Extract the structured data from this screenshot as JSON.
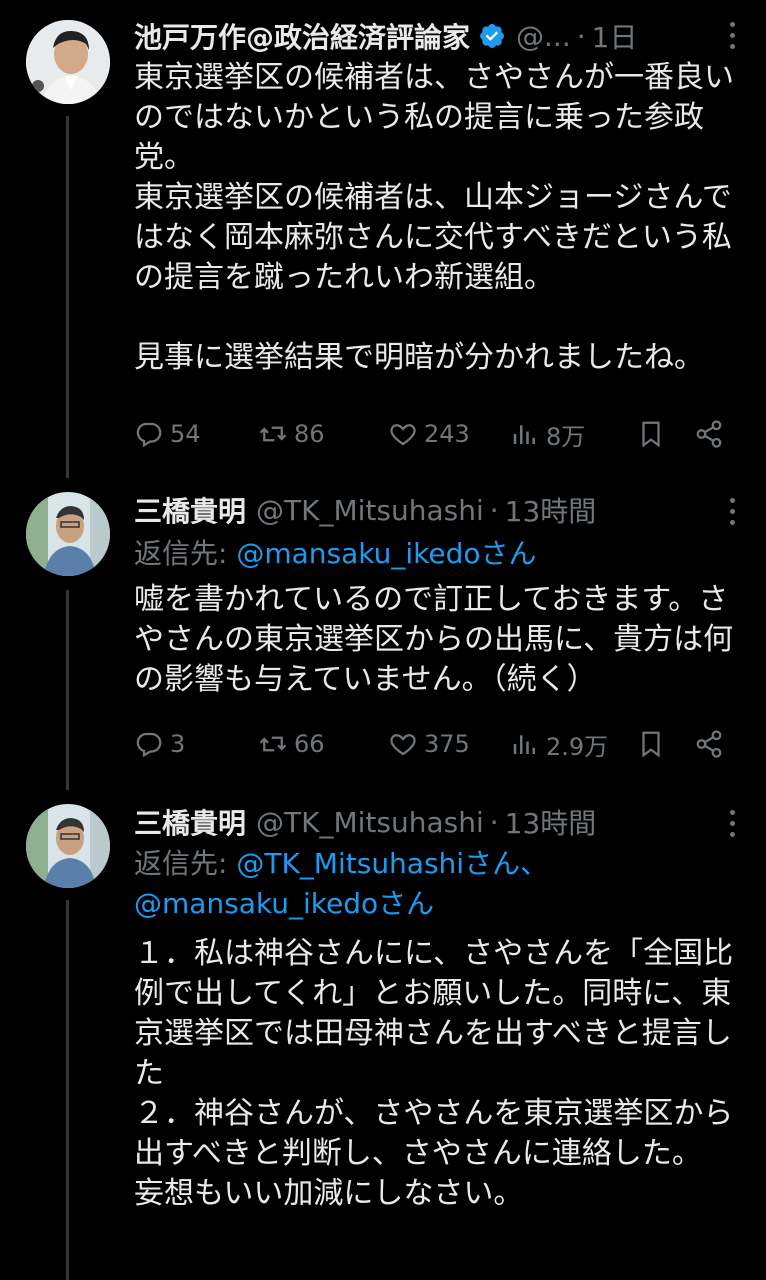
{
  "tweets": [
    {
      "name": "池戸万作@政治経済評論家",
      "handle": "@...",
      "time": "1日",
      "text": "東京選挙区の候補者は、さやさんが一番良いのではないかという私の提言に乗った参政党。\n東京選挙区の候補者は、山本ジョージさんではなく岡本麻弥さんに交代すべきだという私の提言を蹴ったれいわ新選組。\n\n見事に選挙結果で明暗が分かれましたね。",
      "replies": "54",
      "retweets": "86",
      "likes": "243",
      "views": "8万"
    },
    {
      "name": "三橋貴明",
      "handle": "@TK_Mitsuhashi",
      "time": "13時間",
      "reply_prefix": "返信先: ",
      "reply_mentions": "@mansaku_ikedoさん",
      "text": "嘘を書かれているので訂正しておきます。さやさんの東京選挙区からの出馬に、貴方は何の影響も与えていません。（続く）",
      "replies": "3",
      "retweets": "66",
      "likes": "375",
      "views": "2.9万"
    },
    {
      "name": "三橋貴明",
      "handle": "@TK_Mitsuhashi",
      "time": "13時間",
      "reply_prefix": "返信先: ",
      "reply_mentions_1": "@TK_Mitsuhashiさん、",
      "reply_mentions_2": "@mansaku_ikedoさん",
      "text": "１．私は神谷さんにに、さやさんを「全国比例で出してくれ」とお願いした。同時に、東京選挙区では田母神さんを出すべきと提言した\n２．神谷さんが、さやさんを東京選挙区から出すべきと判断し、さやさんに連絡した。\n妄想もいい加減にしなさい。"
    }
  ],
  "icons": {
    "reply": "reply-icon",
    "retweet": "retweet-icon",
    "like": "heart-icon",
    "views": "views-icon",
    "bookmark": "bookmark-icon",
    "share": "share-icon",
    "more": "more-icon",
    "verified": "verified-badge-icon"
  },
  "colors": {
    "background": "#000000",
    "text": "#e7e9ea",
    "muted": "#71767b",
    "link": "#1d9bf0",
    "verified": "#1d9bf0"
  }
}
